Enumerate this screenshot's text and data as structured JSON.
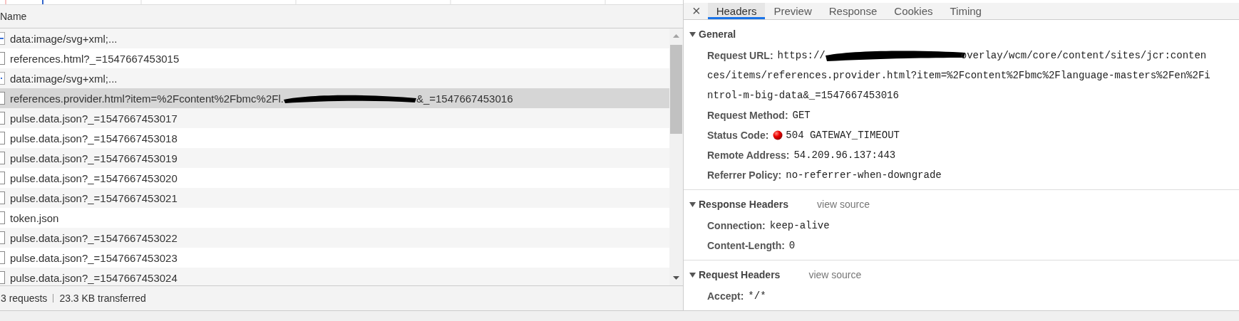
{
  "request_list": {
    "column_header": "Name",
    "rows": [
      {
        "kind": "image",
        "name": "data:image/svg+xml;...",
        "selected": false
      },
      {
        "kind": "file",
        "name": "references.html?_=1547667453015",
        "selected": false
      },
      {
        "kind": "image",
        "name": "data:image/svg+xml;...",
        "selected": false
      },
      {
        "kind": "file",
        "name": "references.provider.html?item=%2Fcontent%2Fbmc%2Fl.",
        "name_after_redaction": "&_=1547667453016",
        "selected": true
      },
      {
        "kind": "file",
        "name": "pulse.data.json?_=1547667453017",
        "selected": false
      },
      {
        "kind": "file",
        "name": "pulse.data.json?_=1547667453018",
        "selected": false
      },
      {
        "kind": "file",
        "name": "pulse.data.json?_=1547667453019",
        "selected": false
      },
      {
        "kind": "file",
        "name": "pulse.data.json?_=1547667453020",
        "selected": false
      },
      {
        "kind": "file",
        "name": "pulse.data.json?_=1547667453021",
        "selected": false
      },
      {
        "kind": "file",
        "name": "token.json",
        "selected": false
      },
      {
        "kind": "file",
        "name": "pulse.data.json?_=1547667453022",
        "selected": false
      },
      {
        "kind": "file",
        "name": "pulse.data.json?_=1547667453023",
        "selected": false
      },
      {
        "kind": "file",
        "name": "pulse.data.json?_=1547667453024",
        "selected": false
      }
    ],
    "status_bar": {
      "requests": "3 requests",
      "transferred": "23.3 KB transferred"
    }
  },
  "details": {
    "close": "×",
    "tabs": [
      {
        "label": "Headers",
        "selected": true
      },
      {
        "label": "Preview",
        "selected": false
      },
      {
        "label": "Response",
        "selected": false
      },
      {
        "label": "Cookies",
        "selected": false
      },
      {
        "label": "Timing",
        "selected": false
      }
    ],
    "sections": [
      {
        "title": "General",
        "expanded": true,
        "fields": [
          {
            "kind": "url",
            "label": "Request URL:",
            "value": "https://",
            "value_after_redaction": "overlay/wcm/core/content/sites/jcr:conten",
            "continuation": [
              "ces/items/references.provider.html?item=%2Fcontent%2Fbmc%2Flanguage-masters%2Fen%2Fi",
              "ntrol-m-big-data&_=1547667453016"
            ]
          },
          {
            "kind": "text",
            "label": "Request Method:",
            "value": "GET"
          },
          {
            "kind": "status",
            "label": "Status Code:",
            "value": "504 GATEWAY_TIMEOUT"
          },
          {
            "kind": "text",
            "label": "Remote Address:",
            "value": "54.209.96.137:443"
          },
          {
            "kind": "text",
            "label": "Referrer Policy:",
            "value": "no-referrer-when-downgrade"
          }
        ]
      },
      {
        "title": "Response Headers",
        "link": "view source",
        "expanded": true,
        "fields": [
          {
            "kind": "text",
            "label": "Connection:",
            "value": "keep-alive"
          },
          {
            "kind": "text",
            "label": "Content-Length:",
            "value": "0"
          }
        ]
      },
      {
        "title": "Request Headers",
        "link": "view source",
        "expanded": true,
        "fields": [
          {
            "kind": "text",
            "label": "Accept:",
            "value": "*/*"
          }
        ]
      }
    ]
  }
}
